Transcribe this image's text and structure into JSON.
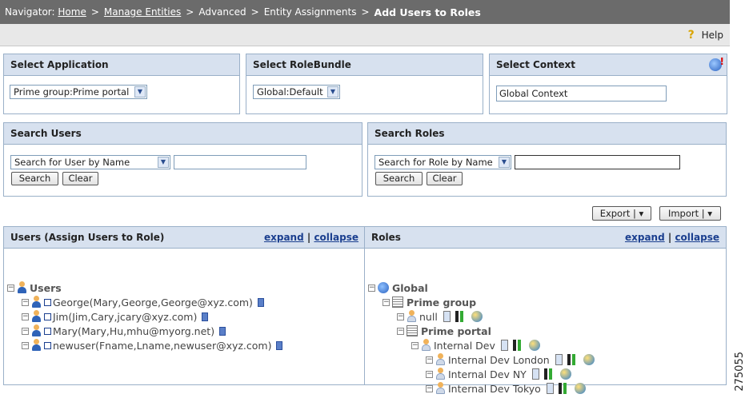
{
  "navigator": {
    "label": "Navigator:",
    "crumbs": [
      "Home",
      "Manage Entities",
      "Advanced",
      "Entity Assignments"
    ],
    "current": "Add Users to Roles",
    "separator": ">"
  },
  "helpbar": {
    "help_label": "Help"
  },
  "select_application": {
    "title": "Select Application",
    "value": "Prime group:Prime portal"
  },
  "select_rolebundle": {
    "title": "Select RoleBundle",
    "value": "Global:Default"
  },
  "select_context": {
    "title": "Select Context",
    "value": "Global Context"
  },
  "search_users": {
    "title": "Search Users",
    "mode": "Search for User by Name",
    "query": "",
    "search_label": "Search",
    "clear_label": "Clear"
  },
  "search_roles": {
    "title": "Search Roles",
    "mode": "Search for Role by Name",
    "query": "",
    "search_label": "Search",
    "clear_label": "Clear"
  },
  "actions": {
    "export_label": "Export | ▾",
    "import_label": "Import | ▾"
  },
  "users_panel": {
    "title": "Users (Assign Users to Role)",
    "expand": "expand",
    "sep": "|",
    "collapse": "collapse",
    "root": "Users",
    "items": [
      "George(Mary,George,George@xyz.com)",
      "Jim(Jim,Cary,jcary@xyz.com)",
      "Mary(Mary,Hu,mhu@myorg.net)",
      "newuser(Fname,Lname,newuser@xyz.com)"
    ]
  },
  "roles_panel": {
    "title": "Roles",
    "expand": "expand",
    "sep": "|",
    "collapse": "collapse",
    "global": "Global",
    "group": "Prime group",
    "null_role": "null",
    "portal": "Prime portal",
    "internal_dev": "Internal Dev",
    "children": [
      "Internal Dev London",
      "Internal Dev NY",
      "Internal Dev Tokyo"
    ]
  },
  "figure_number": "275055",
  "colors": {
    "nav_bg": "#6b6b6b",
    "panel_head": "#d7e1ef",
    "panel_border": "#9ab0c8",
    "link": "#1b3f8f"
  }
}
